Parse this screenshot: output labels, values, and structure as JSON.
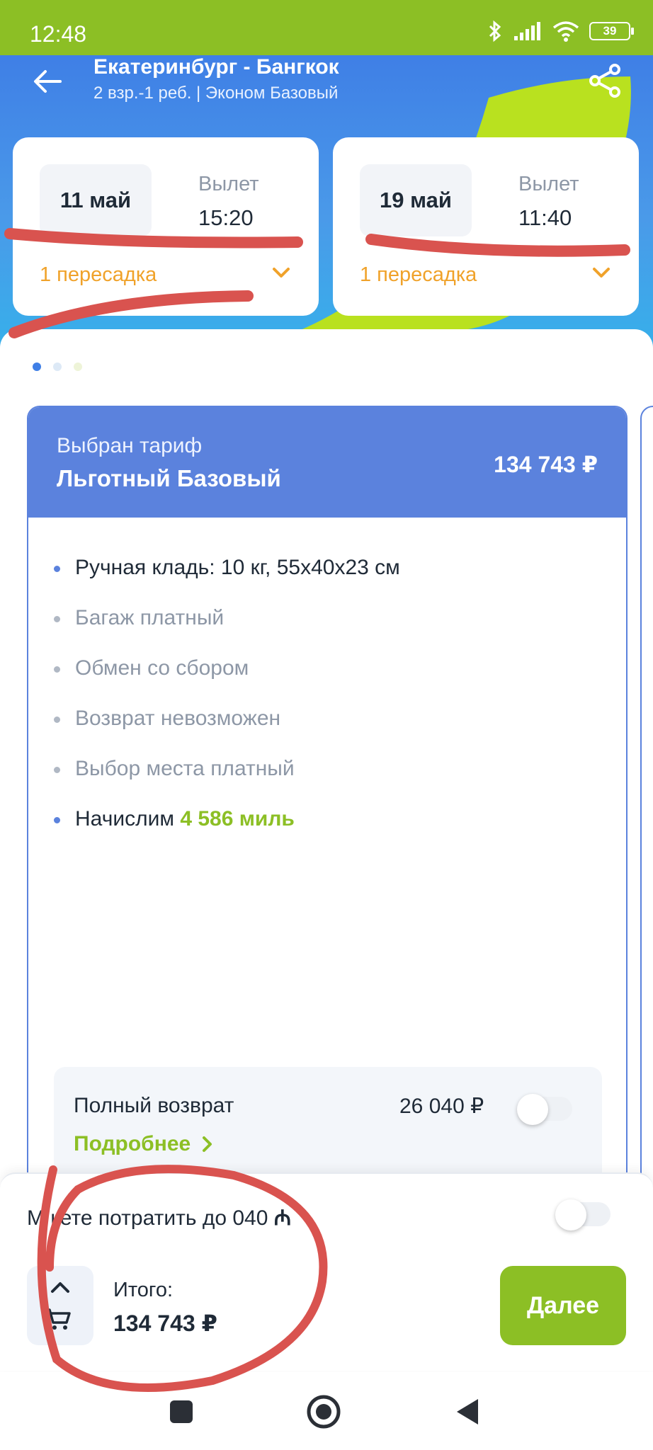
{
  "status_bar": {
    "time": "12:48",
    "battery": "39",
    "icons": [
      "bluetooth-icon",
      "signal-icon",
      "wifi-icon",
      "battery-icon"
    ]
  },
  "header": {
    "title": "Екатеринбург - Бангкок",
    "subtitle": "2 взр.-1 реб. | Эконом Базовый"
  },
  "flights": [
    {
      "date": "11 май",
      "departure_label": "Вылет",
      "departure_time": "15:20",
      "transfers": "1 пересадка"
    },
    {
      "date": "19 май",
      "departure_label": "Вылет",
      "departure_time": "11:40",
      "transfers": "1 пересадка"
    }
  ],
  "tariff": {
    "chosen_label": "Выбран тариф",
    "name": "Льготный Базовый",
    "price": "134 743 ₽",
    "features": [
      "Ручная кладь: 10 кг, 55х40х23 см",
      "Багаж платный",
      "Обмен со сбором",
      "Возврат невозможен",
      "Выбор места платный"
    ],
    "miles_prefix": "Начислим",
    "miles_value": "4 586 миль"
  },
  "refund": {
    "title": "Полный возврат",
    "price": "26 040 ₽",
    "more_label": "Подробнее",
    "enabled": false
  },
  "bottom": {
    "miles_spend_text": "М   кете потратить до   040 ",
    "miles_symbol": "₼",
    "miles_toggle_enabled": false,
    "total_label": "Итого:",
    "total_value": "134 743 ₽",
    "next_label": "Далее"
  },
  "colors": {
    "status_bar": "#8cbf25",
    "accent_green": "#8cbf25",
    "tariff_blue": "#5b82dd",
    "transfer_orange": "#f0a22a",
    "annotation_red": "#d9534f"
  }
}
